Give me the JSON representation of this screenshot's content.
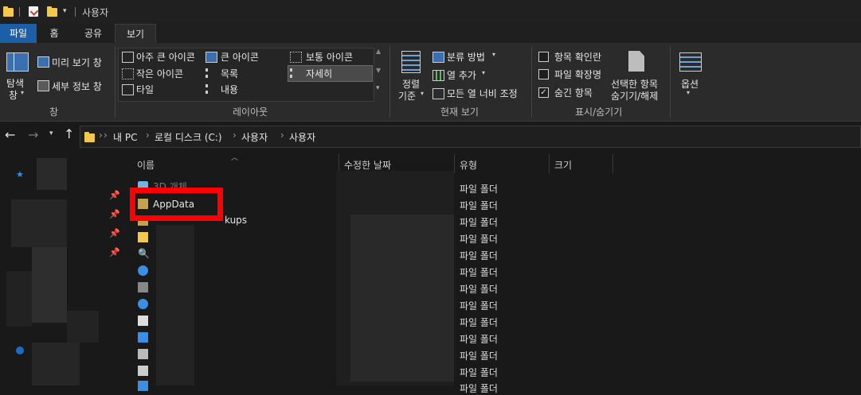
{
  "titlebar": {
    "title": "사용자"
  },
  "tabs": [
    {
      "label": "파일"
    },
    {
      "label": "홈"
    },
    {
      "label": "공유"
    },
    {
      "label": "보기"
    }
  ],
  "ribbon": {
    "pane_group": {
      "nav_pane": "탐색",
      "nav_pane_sub": "창",
      "preview": "미리 보기 창",
      "details": "세부 정보 창",
      "group_label": "창"
    },
    "layout_group": {
      "items": [
        "아주 큰 아이콘",
        "큰 아이콘",
        "보통 아이콘",
        "작은 아이콘",
        "목록",
        "자세히",
        "타일",
        "내용"
      ],
      "group_label": "레이아웃"
    },
    "current_view": {
      "sort": "정렬",
      "sort_sub": "기준",
      "group_by": "분류 방법",
      "add_column": "열 추가",
      "fit_columns": "모든 열 너비 조정",
      "group_label": "현재 보기"
    },
    "show_hide": {
      "item_checkboxes": "항목 확인란",
      "file_extensions": "파일 확장명",
      "hidden_items": "숨긴 항목",
      "hide_selected": "선택한 항목",
      "hide_selected_sub": "숨기기/해제",
      "group_label": "표시/숨기기"
    },
    "options": {
      "label": "옵션"
    }
  },
  "address": {
    "crumbs": [
      "내 PC",
      "로컬 디스크 (C:)",
      "사용자",
      "사용자"
    ]
  },
  "columns": {
    "name": "이름",
    "modified": "수정한 날짜",
    "type": "유형",
    "size": "크기"
  },
  "rows": [
    {
      "name": "3D 개체",
      "type": "파일 폴더"
    },
    {
      "name": "AppData",
      "type": "파일 폴더"
    },
    {
      "name": "kups",
      "type": "파일 폴더"
    },
    {
      "type": "파일 폴더"
    },
    {
      "type": "파일 폴더"
    },
    {
      "type": "파일 폴더"
    },
    {
      "type": "파일 폴더"
    },
    {
      "type": "파일 폴더"
    },
    {
      "type": "파일 폴더"
    },
    {
      "type": "파일 폴더"
    },
    {
      "type": "파일 폴더"
    },
    {
      "type": "파일 폴더"
    },
    {
      "type": "파일 폴더"
    }
  ],
  "highlight_color": "#ff0000",
  "accent_color": "#1a5fa8"
}
